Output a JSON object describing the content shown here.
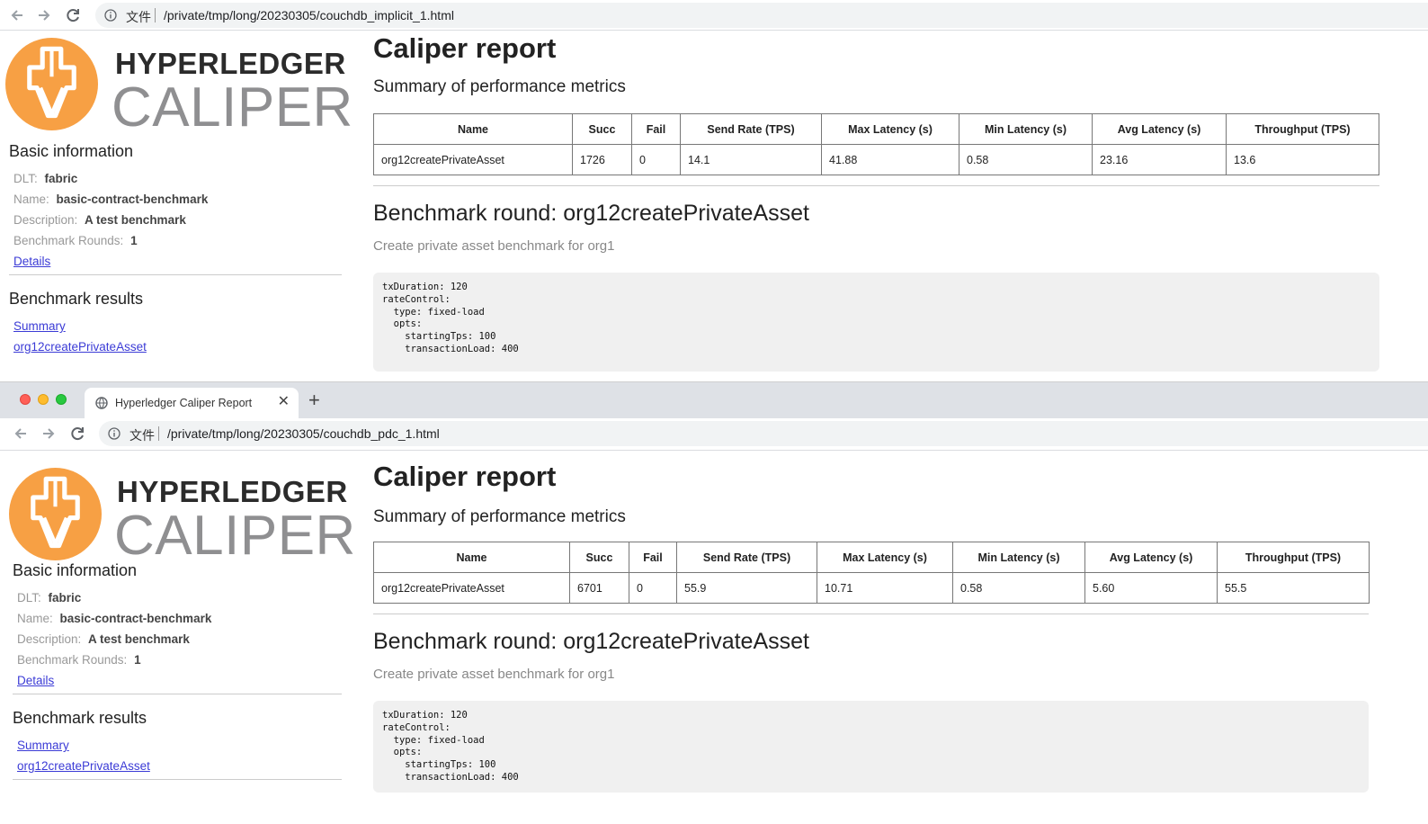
{
  "windows": [
    {
      "url": "/private/tmp/long/20230305/couchdb_implicit_1.html",
      "omni_label": "文件",
      "logo": {
        "top": "HYPERLEDGER",
        "bottom": "CALIPER"
      },
      "basic": {
        "title": "Basic information",
        "dlt_label": "DLT:",
        "dlt": "fabric",
        "name_label": "Name:",
        "name": "basic-contract-benchmark",
        "desc_label": "Description:",
        "desc": "A test benchmark",
        "rounds_label": "Benchmark Rounds:",
        "rounds": "1",
        "details": "Details"
      },
      "results": {
        "title": "Benchmark results",
        "links": [
          "Summary",
          "org12createPrivateAsset"
        ]
      },
      "report": {
        "title": "Caliper report",
        "summary_title": "Summary of performance metrics",
        "headers": [
          "Name",
          "Succ",
          "Fail",
          "Send Rate (TPS)",
          "Max Latency (s)",
          "Min Latency (s)",
          "Avg Latency (s)",
          "Throughput (TPS)"
        ],
        "row": [
          "org12createPrivateAsset",
          "1726",
          "0",
          "14.1",
          "41.88",
          "0.58",
          "23.16",
          "13.6"
        ],
        "round_title": "Benchmark round: org12createPrivateAsset",
        "round_desc": "Create private asset benchmark for org1",
        "config": "txDuration: 120\nrateControl:\n  type: fixed-load\n  opts:\n    startingTps: 100\n    transactionLoad: 400"
      }
    },
    {
      "tab_title": "Hyperledger Caliper Report",
      "url": "/private/tmp/long/20230305/couchdb_pdc_1.html",
      "omni_label": "文件",
      "logo": {
        "top": "HYPERLEDGER",
        "bottom": "CALIPER"
      },
      "basic": {
        "title": "Basic information",
        "dlt_label": "DLT:",
        "dlt": "fabric",
        "name_label": "Name:",
        "name": "basic-contract-benchmark",
        "desc_label": "Description:",
        "desc": "A test benchmark",
        "rounds_label": "Benchmark Rounds:",
        "rounds": "1",
        "details": "Details"
      },
      "results": {
        "title": "Benchmark results",
        "links": [
          "Summary",
          "org12createPrivateAsset"
        ]
      },
      "report": {
        "title": "Caliper report",
        "summary_title": "Summary of performance metrics",
        "headers": [
          "Name",
          "Succ",
          "Fail",
          "Send Rate (TPS)",
          "Max Latency (s)",
          "Min Latency (s)",
          "Avg Latency (s)",
          "Throughput (TPS)"
        ],
        "row": [
          "org12createPrivateAsset",
          "6701",
          "0",
          "55.9",
          "10.71",
          "0.58",
          "5.60",
          "55.5"
        ],
        "round_title": "Benchmark round: org12createPrivateAsset",
        "round_desc": "Create private asset benchmark for org1",
        "config": "txDuration: 120\nrateControl:\n  type: fixed-load\n  opts:\n    startingTps: 100\n    transactionLoad: 400"
      }
    }
  ],
  "colors": {
    "logo_orange": "#f7a044",
    "link": "#3b3bd6",
    "code_bg": "#f0f0f0"
  }
}
